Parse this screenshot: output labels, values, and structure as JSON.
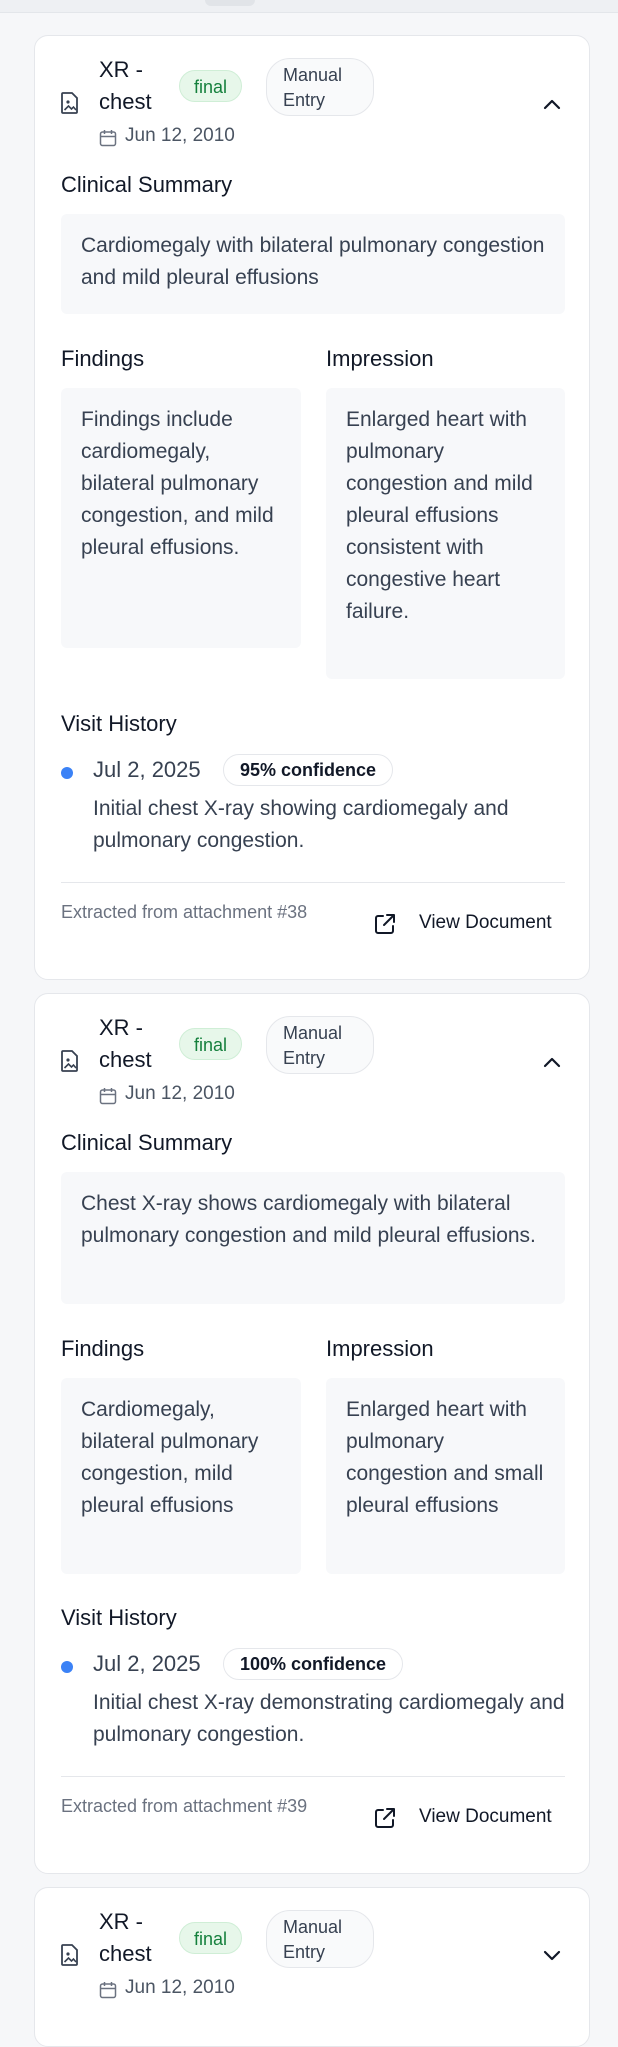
{
  "cards": [
    {
      "title": "XR - chest",
      "status": "final",
      "source": "Manual Entry",
      "date": "Jun 12, 2010",
      "expanded": true,
      "clinical_summary_label": "Clinical Summary",
      "clinical_summary": "Cardiomegaly with bilateral pulmonary congestion and mild pleural effusions",
      "findings_label": "Findings",
      "findings": "Findings include cardiomegaly, bilateral pulmonary congestion, and mild pleural effusions.",
      "impression_label": "Impression",
      "impression": "Enlarged heart with pulmonary congestion and mild pleural effusions consistent with congestive heart failure.",
      "visit_history_label": "Visit History",
      "visit": {
        "date": "Jul 2, 2025",
        "confidence": "95% confidence",
        "note": "Initial chest X-ray showing cardiomegaly and pulmonary congestion."
      },
      "extracted": "Extracted from attachment #38",
      "view_document": "View Document"
    },
    {
      "title": "XR - chest",
      "status": "final",
      "source": "Manual Entry",
      "date": "Jun 12, 2010",
      "expanded": true,
      "clinical_summary_label": "Clinical Summary",
      "clinical_summary": "Chest X-ray shows cardiomegaly with bilateral pulmonary congestion and mild pleural effusions.",
      "findings_label": "Findings",
      "findings": "Cardiomegaly, bilateral pulmonary congestion, mild pleural effusions",
      "impression_label": "Impression",
      "impression": "Enlarged heart with pulmonary congestion and small pleural effusions",
      "visit_history_label": "Visit History",
      "visit": {
        "date": "Jul 2, 2025",
        "confidence": "100% confidence",
        "note": "Initial chest X-ray demonstrating cardiomegaly and pulmonary congestion."
      },
      "extracted": "Extracted from attachment #39",
      "view_document": "View Document"
    },
    {
      "title": "XR - chest",
      "status": "final",
      "source": "Manual Entry",
      "date": "Jun 12, 2010",
      "expanded": false
    }
  ],
  "colors": {
    "status_final_bg": "#e7f7ea",
    "status_final_text": "#15803d",
    "visit_dot": "#3b82f6",
    "summary_box_bg": "#f7f8fa"
  },
  "icons": {
    "document": "file-image-icon",
    "calendar": "calendar-icon",
    "collapse": "chevron-up-icon",
    "expand": "chevron-down-icon",
    "external_link": "external-link-icon"
  }
}
